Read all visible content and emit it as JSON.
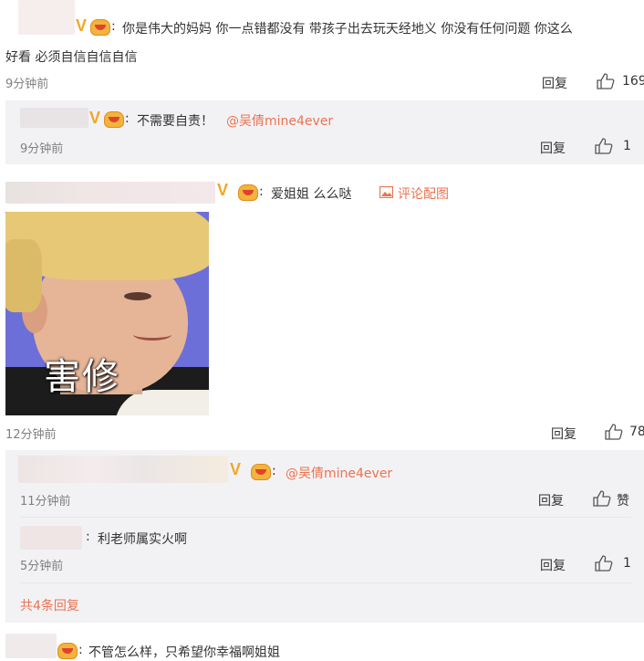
{
  "comment1": {
    "text": "你是伟大的妈妈 你一点错都没有 带孩子出去玩天经地义 你没有任何问题 你这么",
    "text_cont": "好看 必须自信自信自信",
    "time": "9分钟前",
    "reply_label": "回复",
    "likes": "169"
  },
  "reply1": {
    "text": "不需要自责！",
    "mention": "@吴倩mine4ever",
    "time": "9分钟前",
    "reply_label": "回复",
    "likes": "1"
  },
  "comment2": {
    "text": "爱姐姐 么么哒",
    "image_link": "评论配图",
    "image_caption": "害修",
    "time": "12分钟前",
    "reply_label": "回复",
    "likes": "78"
  },
  "thread2": {
    "r1_mention": "@吴倩mine4ever",
    "r1_time": "11分钟前",
    "r1_reply_label": "回复",
    "r1_like_label": "赞",
    "r2_text": "利老师属实火啊",
    "r2_time": "5分钟前",
    "r2_reply_label": "回复",
    "r2_likes": "1",
    "more": "共4条回复"
  },
  "comment3": {
    "text": "不管怎么样，只希望你幸福啊姐姐"
  },
  "colors": {
    "accent": "#eb7350",
    "reply_bg": "#f2f2f5",
    "verified": "#f5a623"
  }
}
